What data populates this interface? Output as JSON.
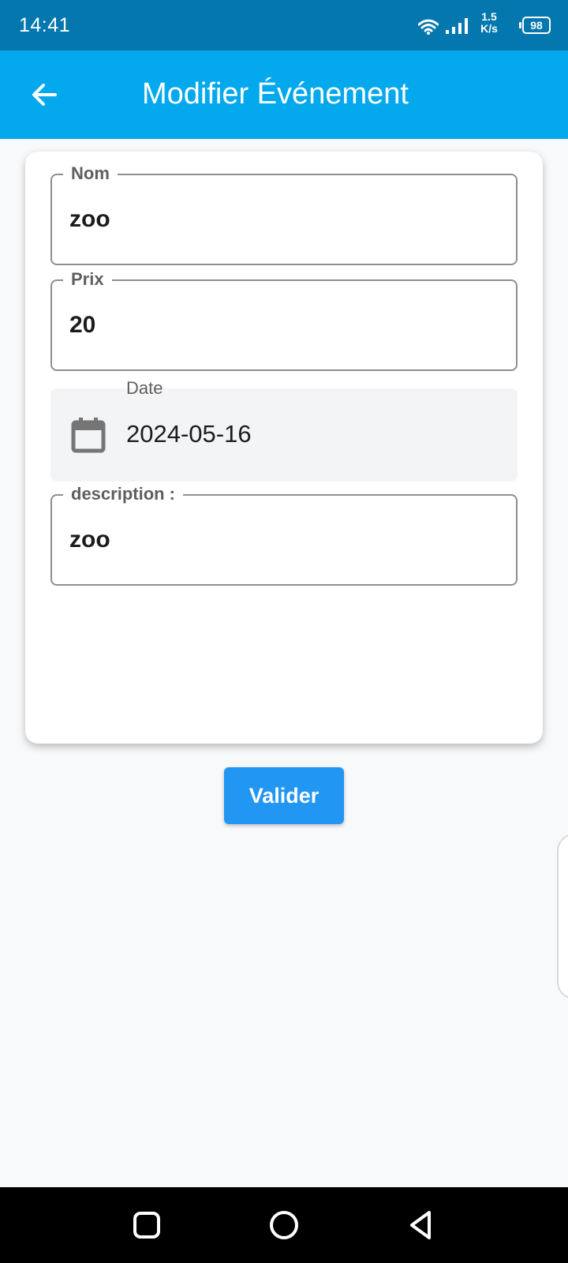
{
  "status_bar": {
    "time": "14:41",
    "net_speed_value": "1.5",
    "net_speed_unit": "K/s",
    "battery": "98",
    "icons": [
      "wifi-icon",
      "signal-icon",
      "battery-icon"
    ]
  },
  "app_bar": {
    "title": "Modifier Événement",
    "back_icon": "arrow-left-icon",
    "background": "#03a9ec"
  },
  "form": {
    "name": {
      "label": "Nom",
      "value": "zoo"
    },
    "price": {
      "label": "Prix",
      "value": "20"
    },
    "date": {
      "label": "Date",
      "value": "2024-05-16",
      "icon": "calendar-icon"
    },
    "description": {
      "label": "description :",
      "value": "zoo"
    }
  },
  "actions": {
    "submit_label": "Valider",
    "submit_color": "#2196f3"
  },
  "navigation_bar": {
    "buttons": [
      "recents-button",
      "home-button",
      "back-button"
    ]
  },
  "colors": {
    "status_bar": "#0377ae",
    "page_background": "#f8f9fb"
  }
}
